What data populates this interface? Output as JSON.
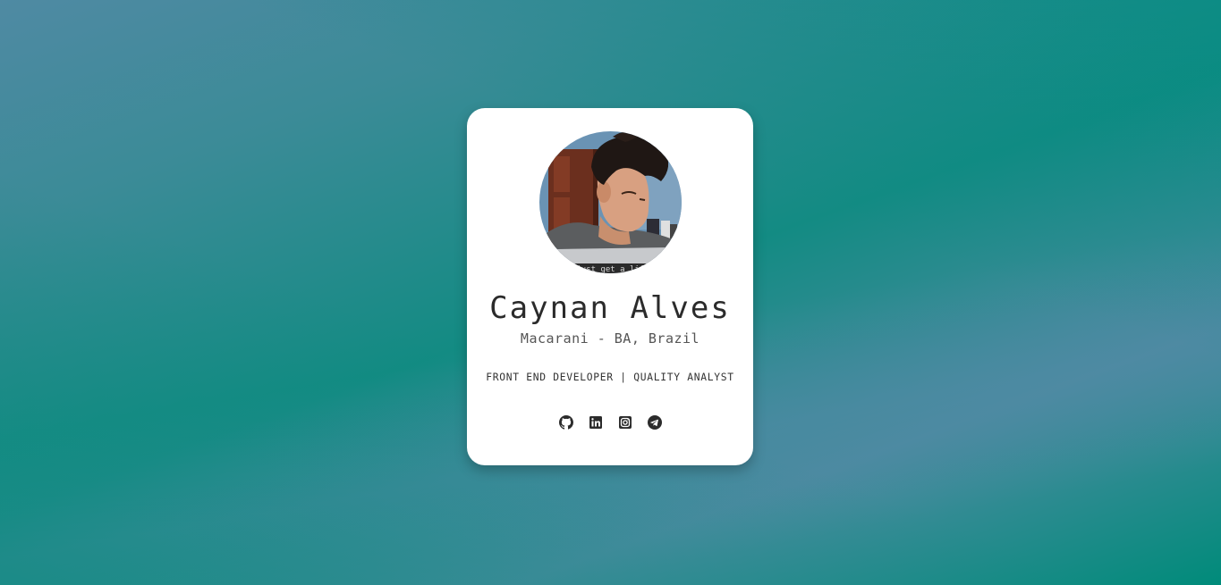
{
  "profile": {
    "name": "Caynan Alves",
    "location": "Macarani - BA, Brazil",
    "role": "FRONT END DEVELOPER | QUALITY ANALYST",
    "avatar_caption": "just get a life"
  },
  "socials": [
    {
      "label": "GitHub",
      "icon": "github-icon"
    },
    {
      "label": "LinkedIn",
      "icon": "linkedin-icon"
    },
    {
      "label": "Instagram",
      "icon": "instagram-icon"
    },
    {
      "label": "Telegram",
      "icon": "telegram-icon"
    }
  ],
  "colors": {
    "card": "#ffffff",
    "text": "#2b2b2b",
    "icon": "#2b2b2b",
    "background_teal": "#008b7a",
    "background_blue": "#4f8aa3"
  }
}
